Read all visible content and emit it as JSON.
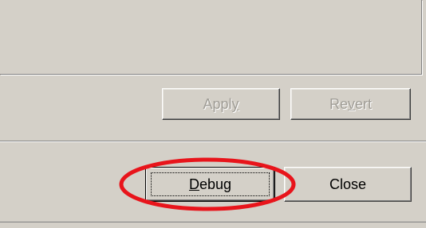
{
  "buttons": {
    "apply": {
      "pre": "Appl",
      "mnemonic": "y",
      "post": ""
    },
    "revert": {
      "pre": "Re",
      "mnemonic": "v",
      "post": "ert"
    },
    "debug": {
      "pre": "",
      "mnemonic": "D",
      "post": "ebug"
    },
    "close": {
      "label": "Close"
    }
  },
  "colors": {
    "window_face": "#d4d0c8",
    "annotation": "#e8141b",
    "disabled_text": "#a09d96"
  }
}
